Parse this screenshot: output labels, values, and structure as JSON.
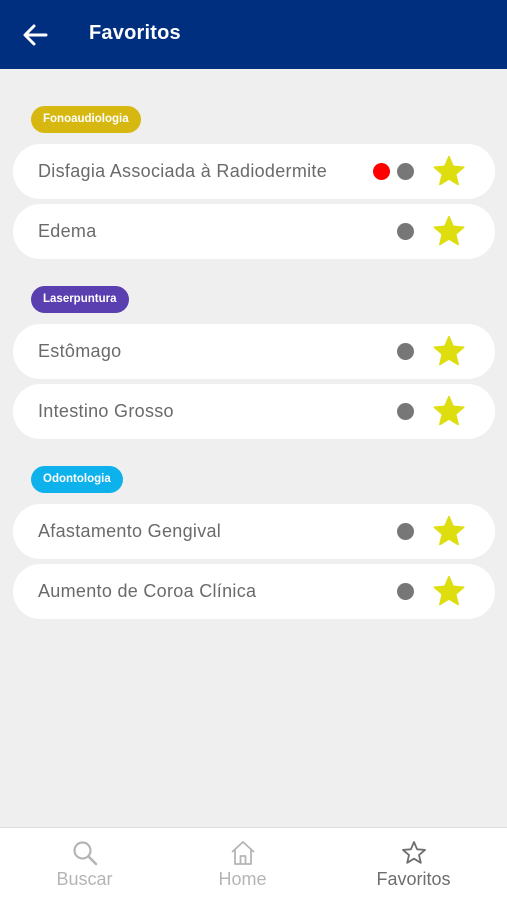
{
  "header": {
    "back_icon": "arrow-left-icon",
    "title": "Favoritos",
    "background_color": "#002f80"
  },
  "sections": [
    {
      "tag": "Fonoaudiologia",
      "color": "#d6b810",
      "items": [
        {
          "label": "Disfagia Associada à Radiodermite",
          "status_dots": [
            "#ff0000",
            "#777777"
          ],
          "favorite": true
        },
        {
          "label": "Edema",
          "status_dots": [
            "#777777"
          ],
          "favorite": true
        }
      ]
    },
    {
      "tag": "Laserpuntura",
      "color": "#5a3fb0",
      "items": [
        {
          "label": "Estômago",
          "status_dots": [
            "#777777"
          ],
          "favorite": true
        },
        {
          "label": "Intestino Grosso",
          "status_dots": [
            "#777777"
          ],
          "favorite": true
        }
      ]
    },
    {
      "tag": "Odontologia",
      "color": "#0db2ec",
      "items": [
        {
          "label": "Afastamento Gengival",
          "status_dots": [
            "#777777"
          ],
          "favorite": true
        },
        {
          "label": "Aumento de Coroa Clínica",
          "status_dots": [
            "#777777"
          ],
          "favorite": true
        }
      ]
    }
  ],
  "favorite_star_color": "#dede0f",
  "bottom_nav": {
    "items": [
      {
        "label": "Buscar",
        "icon": "search-icon",
        "active": false
      },
      {
        "label": "Home",
        "icon": "home-icon",
        "active": false
      },
      {
        "label": "Favoritos",
        "icon": "star-outline-icon",
        "active": true
      }
    ],
    "inactive_color": "#b5b5b5",
    "active_color": "#6e6e6e"
  }
}
